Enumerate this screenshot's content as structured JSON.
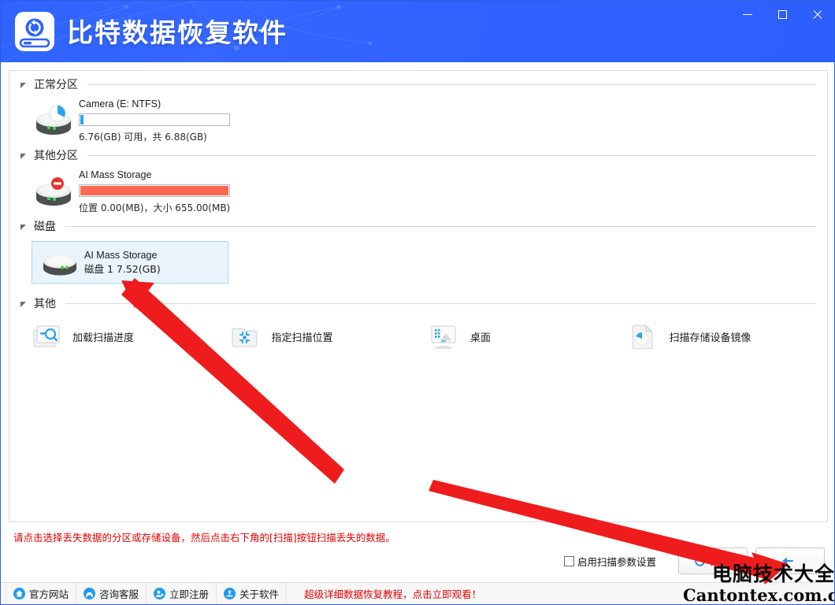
{
  "window": {
    "app_title": "比特数据恢复软件",
    "logo_icon": "disk-recovery-logo-icon",
    "controls": {
      "minimize": "minimize-icon",
      "maximize": "maximize-icon",
      "close": "close-icon"
    }
  },
  "groups": [
    {
      "label": "正常分区",
      "collapse_icon": "collapse-triangle-icon"
    },
    {
      "label": "其他分区",
      "collapse_icon": "collapse-triangle-icon"
    },
    {
      "label": "磁盘",
      "collapse_icon": "collapse-triangle-icon"
    },
    {
      "label": "其他",
      "collapse_icon": "collapse-triangle-icon"
    }
  ],
  "normal_partitions": [
    {
      "name": "Camera (E: NTFS)",
      "icon": "partition-drive-icon",
      "usage_percent": 2,
      "bar_color": "#29a0ef",
      "detail": "6.76(GB) 可用，共 6.88(GB)"
    }
  ],
  "other_partitions": [
    {
      "name": "AI Mass Storage",
      "icon": "partition-drive-blocked-icon",
      "usage_percent": 100,
      "bar_color": "#fd6851",
      "detail": "位置 0.00(MB)，大小 655.00(MB)"
    }
  ],
  "disks": [
    {
      "name": "AI Mass Storage",
      "icon": "hard-disk-icon",
      "detail": "磁盘 1    7.52(GB)",
      "selected": true,
      "selected_bg": "#e9f4fc",
      "selected_border": "#a9d5ef"
    }
  ],
  "other_actions": [
    {
      "label": "加载扫描进度",
      "icon": "load-scan-progress-icon"
    },
    {
      "label": "指定扫描位置",
      "icon": "specify-scan-location-folder-icon"
    },
    {
      "label": "桌面",
      "icon": "desktop-monitor-icon"
    },
    {
      "label": "扫描存储设备镜像",
      "icon": "scan-device-image-file-icon"
    }
  ],
  "hint_text": "请点击选择丢失数据的分区或存储设备，然后点击右下角的[扫描]按钮扫描丢失的数据。",
  "bottom_controls": {
    "scan_params_checkbox": {
      "label": "启用扫描参数设置",
      "checked": false
    },
    "refresh_button": {
      "label": "刷新",
      "icon": "refresh-circular-arrow-icon"
    },
    "scan_button": {
      "label": "",
      "icon": "back-arrow-icon"
    }
  },
  "status_bar": {
    "items": [
      {
        "label": "官方网站",
        "icon": "home-icon",
        "color": "#1d9bf0"
      },
      {
        "label": "咨询客服",
        "icon": "headset-support-icon",
        "color": "#1d9bf0"
      },
      {
        "label": "立即注册",
        "icon": "user-register-icon",
        "color": "#1d9bf0"
      },
      {
        "label": "关于软件",
        "icon": "info-about-icon",
        "color": "#1d9bf0"
      }
    ],
    "promo": "超级详细数据恢复教程，点击立即观看！"
  },
  "watermark": {
    "chinese": "电脑技术大全",
    "english": "Cantontex.com.cn"
  },
  "annotations": {
    "arrow_color": "#ee1c1c",
    "arrows": [
      {
        "name": "arrow-pointing-to-disk-tile"
      },
      {
        "name": "arrow-pointing-to-scan-button"
      }
    ]
  }
}
